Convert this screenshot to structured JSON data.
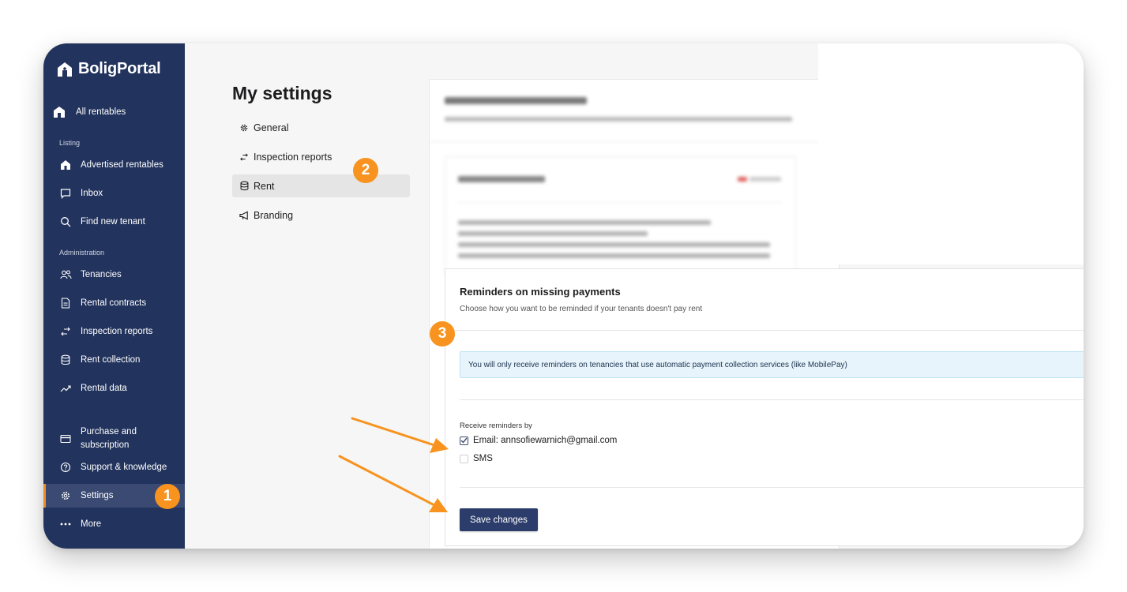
{
  "brand": {
    "name": "BoligPortal"
  },
  "sidebar": {
    "all_rentables": "All rentables",
    "section_listing": "Listing",
    "section_admin": "Administration",
    "items": [
      {
        "label": "Advertised rentables",
        "icon": "house-icon"
      },
      {
        "label": "Inbox",
        "icon": "chat-icon"
      },
      {
        "label": "Find new tenant",
        "icon": "search-icon"
      },
      {
        "label": "Tenancies",
        "icon": "people-icon"
      },
      {
        "label": "Rental contracts",
        "icon": "document-icon"
      },
      {
        "label": "Inspection reports",
        "icon": "arrows-icon"
      },
      {
        "label": "Rent collection",
        "icon": "database-icon"
      },
      {
        "label": "Rental data",
        "icon": "trend-icon"
      }
    ],
    "purchase_line1": "Purchase and",
    "purchase_line2": "subscription",
    "support": "Support & knowledge",
    "settings": "Settings",
    "more": "More"
  },
  "settings_menu": {
    "title": "My settings",
    "items": [
      {
        "label": "General",
        "icon": "gear-icon"
      },
      {
        "label": "Inspection reports",
        "icon": "arrows-icon"
      },
      {
        "label": "Rent",
        "icon": "database-icon"
      },
      {
        "label": "Branding",
        "icon": "megaphone-icon"
      }
    ],
    "active": "Rent"
  },
  "reminders": {
    "title": "Reminders on missing payments",
    "subtitle": "Choose how you want to be reminded if your tenants doesn't pay rent",
    "info": "You will only receive reminders on tenancies that use automatic payment collection services (like MobilePay)",
    "receive_label": "Receive reminders by",
    "email_option": "Email: annsofiewarnich@gmail.com",
    "email_checked": true,
    "sms_option": "SMS",
    "sms_checked": false,
    "save_label": "Save changes"
  },
  "annotations": {
    "badge1": "1",
    "badge2": "2",
    "badge3": "3",
    "color": "#f7931e"
  },
  "colors": {
    "sidebar": "#22335d",
    "button": "#2c3d6b",
    "info_bg": "#e7f4fb"
  }
}
